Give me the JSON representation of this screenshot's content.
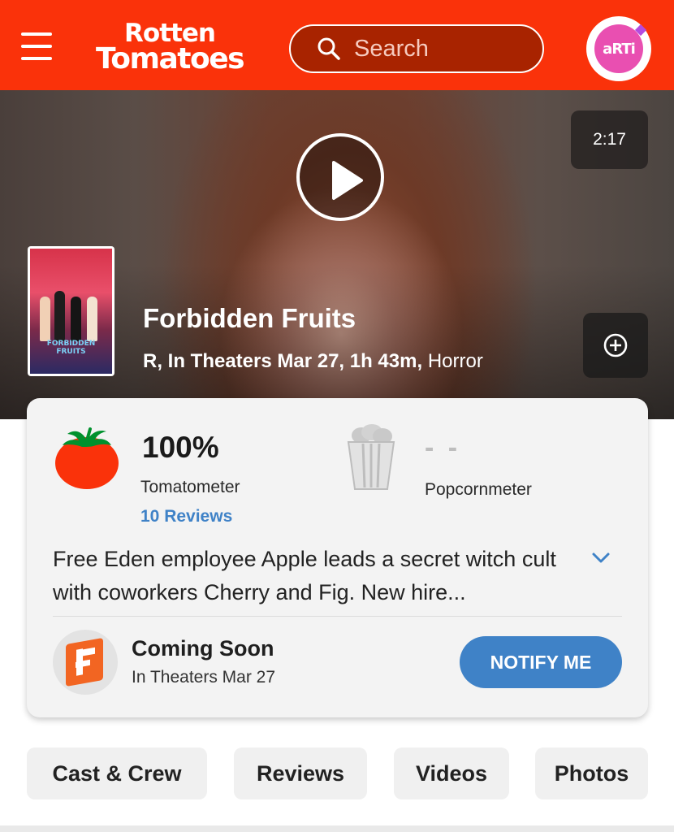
{
  "header": {
    "logo_line1": "Rotten",
    "logo_line2": "Tomatoes",
    "search_placeholder": "Search",
    "avatar_text": "aRTi",
    "brand_color": "#fa320a"
  },
  "hero": {
    "duration": "2:17",
    "poster_title": "FORBIDDEN FRUITS",
    "title": "Forbidden Fruits",
    "meta_main": "R, In Theaters Mar 27, 1h 43m,",
    "genre": "Horror"
  },
  "scores": {
    "tomatometer_value": "100%",
    "tomatometer_label": "Tomatometer",
    "reviews_link": "10 Reviews",
    "popcornmeter_value": "- -",
    "popcornmeter_label": "Popcornmeter"
  },
  "synopsis": {
    "text": "Free Eden employee Apple leads a secret witch cult with coworkers Cherry and Fig. New hire..."
  },
  "showtimes": {
    "title": "Coming Soon",
    "date": "In Theaters Mar 27",
    "notify_label": "NOTIFY ME",
    "accent_color": "#3f82c7"
  },
  "tabs": [
    {
      "label": "Cast & Crew"
    },
    {
      "label": "Reviews"
    },
    {
      "label": "Videos"
    },
    {
      "label": "Photos"
    }
  ]
}
